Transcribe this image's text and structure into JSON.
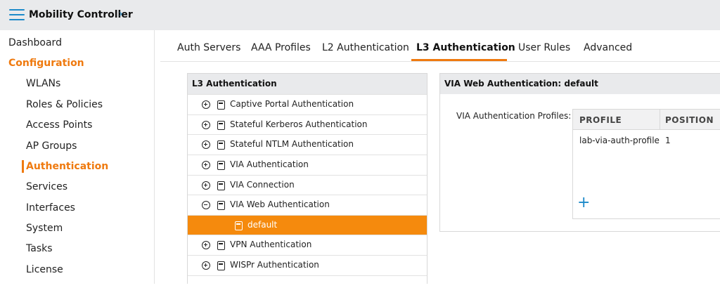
{
  "header": {
    "title": "Mobility Controller",
    "chevron": "›"
  },
  "sidebar": {
    "dashboard": "Dashboard",
    "configuration": "Configuration",
    "items": [
      "WLANs",
      "Roles & Policies",
      "Access Points",
      "AP Groups",
      "Authentication",
      "Services",
      "Interfaces",
      "System",
      "Tasks",
      "License"
    ],
    "active_item": "Authentication"
  },
  "tabs": [
    "Auth Servers",
    "AAA Profiles",
    "L2 Authentication",
    "L3 Authentication",
    "User Rules",
    "Advanced"
  ],
  "active_tab": "L3 Authentication",
  "left_panel": {
    "title": "L3 Authentication",
    "rows": [
      {
        "label": "Captive Portal Authentication",
        "state": "collapsed"
      },
      {
        "label": "Stateful Kerberos Authentication",
        "state": "collapsed"
      },
      {
        "label": "Stateful NTLM Authentication",
        "state": "collapsed"
      },
      {
        "label": "VIA Authentication",
        "state": "collapsed"
      },
      {
        "label": "VIA Connection",
        "state": "collapsed"
      },
      {
        "label": "VIA Web Authentication",
        "state": "expanded"
      },
      {
        "label": "default",
        "state": "selected-child"
      },
      {
        "label": "VPN Authentication",
        "state": "collapsed"
      },
      {
        "label": "WISPr Authentication",
        "state": "collapsed"
      }
    ]
  },
  "right_panel": {
    "title": "VIA Web Authentication: default",
    "field_label": "VIA Authentication Profiles:",
    "table": {
      "columns": [
        "PROFILE",
        "POSITION"
      ],
      "rows": [
        {
          "profile": "lab-via-auth-profile",
          "position": "1"
        }
      ],
      "add_label": "+"
    }
  },
  "colors": {
    "accent_orange": "#ef7a0f",
    "selected_row": "#f58a0d",
    "link_blue": "#1d8ac9",
    "header_bg": "#e9eaec"
  }
}
